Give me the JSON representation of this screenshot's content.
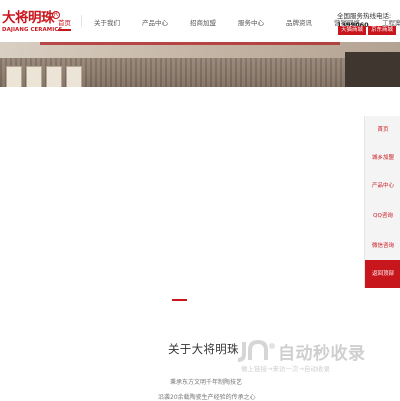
{
  "brand": {
    "name_cn": "大将明珠",
    "name_en": "DAJIANG CERAMICS",
    "registered_mark": "R",
    "color": "#c8161d"
  },
  "nav": {
    "items": [
      {
        "label": "首页",
        "active": true
      },
      {
        "label": "关于我们"
      },
      {
        "label": "产品中心"
      },
      {
        "label": "招商加盟"
      },
      {
        "label": "服务中心"
      },
      {
        "label": "品牌资讯"
      },
      {
        "label": "营销网络"
      },
      {
        "label": "工程案例"
      }
    ]
  },
  "header": {
    "hotline_label": "全国服务热线电话:",
    "hotline_number": "1399060",
    "mall_buttons": [
      "天猫商城",
      "京东商城"
    ]
  },
  "side_menu": {
    "items": [
      "首页",
      "城乡加盟",
      "产品中心",
      "QQ咨询",
      "微信咨询",
      "返回顶部"
    ]
  },
  "about": {
    "title": "关于大将明珠",
    "line1": "秉承东方文明千年制陶技艺",
    "line2": "沿袭20余载陶瓷生产经验的传承之心"
  },
  "watermark": {
    "text": "自动秒收录",
    "sub": "做上链接→来访一次→自动收录"
  }
}
